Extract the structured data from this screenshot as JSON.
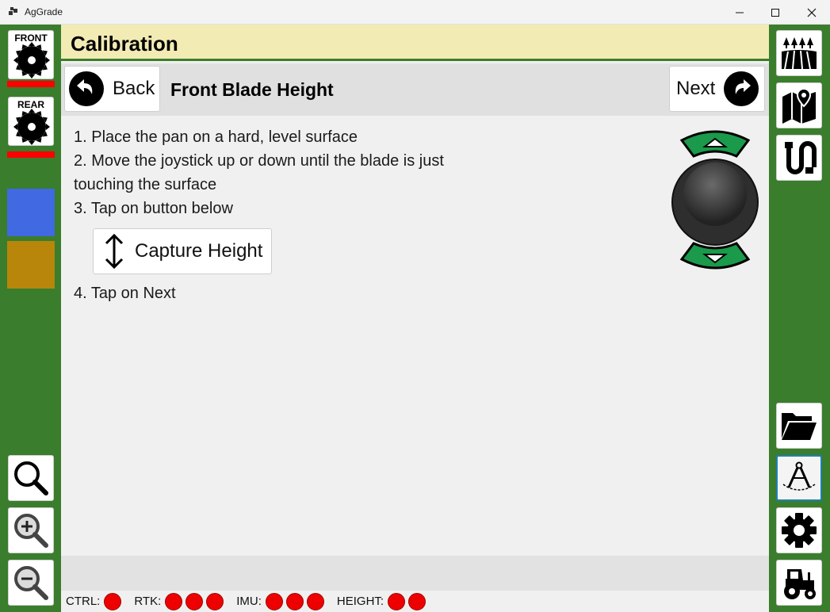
{
  "window": {
    "title": "AgGrade"
  },
  "left": {
    "front_label": "FRONT",
    "rear_label": "REAR",
    "swatch_blue": "#4169e1",
    "swatch_gold": "#b8860b",
    "status_bar_color": "#ff0000"
  },
  "page": {
    "title": "Calibration",
    "step_title": "Front Blade Height",
    "back_label": "Back",
    "next_label": "Next",
    "steps": [
      "1. Place the pan on a hard, level surface",
      "2. Move the joystick up or down until the blade is just",
      "touching the surface",
      "3. Tap on button below",
      "4. Tap on Next"
    ],
    "capture_label": "Capture Height"
  },
  "status": {
    "ctrl_label": "CTRL:",
    "rtk_label": "RTK:",
    "imu_label": "IMU:",
    "height_label": "HEIGHT:"
  },
  "right_icons": [
    "field-icon",
    "map-icon",
    "path-icon",
    "folder-icon",
    "calibration-icon",
    "gear-icon",
    "tractor-icon"
  ],
  "colors": {
    "frame_green": "#3a7d2c",
    "header_yellow": "#f2ebb4",
    "led_red": "#ee0000",
    "joystick_green": "#1a9a4a"
  }
}
